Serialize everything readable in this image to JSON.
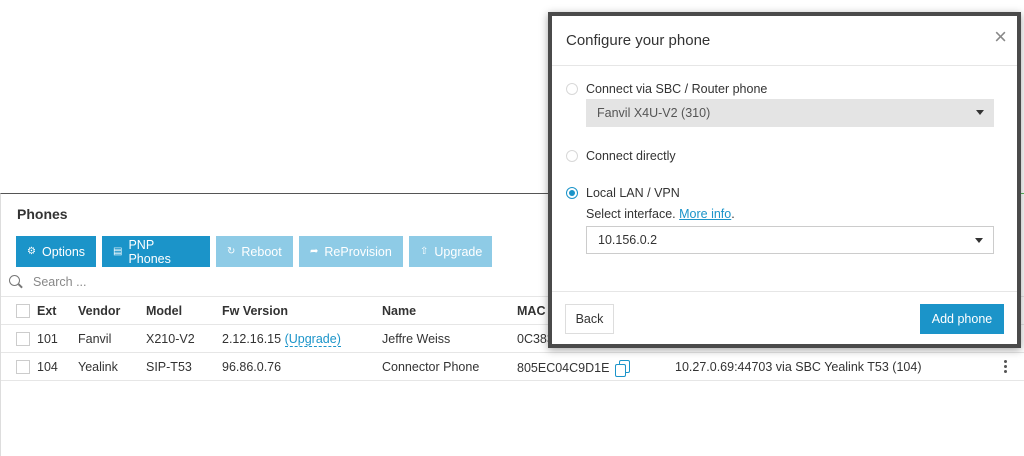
{
  "phones_panel": {
    "title": "Phones",
    "toolbar": {
      "options": "Options",
      "pnp": "PNP Phones",
      "reboot": "Reboot",
      "reprovision": "ReProvision",
      "upgrade": "Upgrade"
    },
    "search": {
      "placeholder": "Search ..."
    },
    "columns": [
      "Ext",
      "Vendor",
      "Model",
      "Fw Version",
      "Name",
      "MAC"
    ],
    "rows": [
      {
        "ext": "101",
        "vendor": "Fanvil",
        "model": "X210-V2",
        "fw": "2.12.16.15",
        "upgrade_link": "(Upgrade)",
        "name": "Jeffre Weiss",
        "mac": "0C383",
        "status": ""
      },
      {
        "ext": "104",
        "vendor": "Yealink",
        "model": "SIP-T53",
        "fw": "96.86.0.76",
        "upgrade_link": "",
        "name": "Connector Phone",
        "mac": "805EC04C9D1E",
        "status": "10.27.0.69:44703 via SBC Yealink T53 (104)"
      }
    ]
  },
  "modal": {
    "title": "Configure your phone",
    "close_icon": "×",
    "options": [
      {
        "label": "Connect via SBC / Router phone",
        "selected": false
      },
      {
        "label": "Connect directly",
        "selected": false
      },
      {
        "label": "Local LAN / VPN",
        "selected": true
      }
    ],
    "sbc_select_value": "Fanvil X4U-V2 (310)",
    "interface_text": "Select interface.",
    "more_info_link": "More info",
    "interface_suffix": ".",
    "interface_select_value": "10.156.0.2",
    "back_button": "Back",
    "add_button": "Add phone"
  },
  "colors": {
    "accent": "#1b94c9",
    "accent_disabled": "#8ecbe6"
  }
}
